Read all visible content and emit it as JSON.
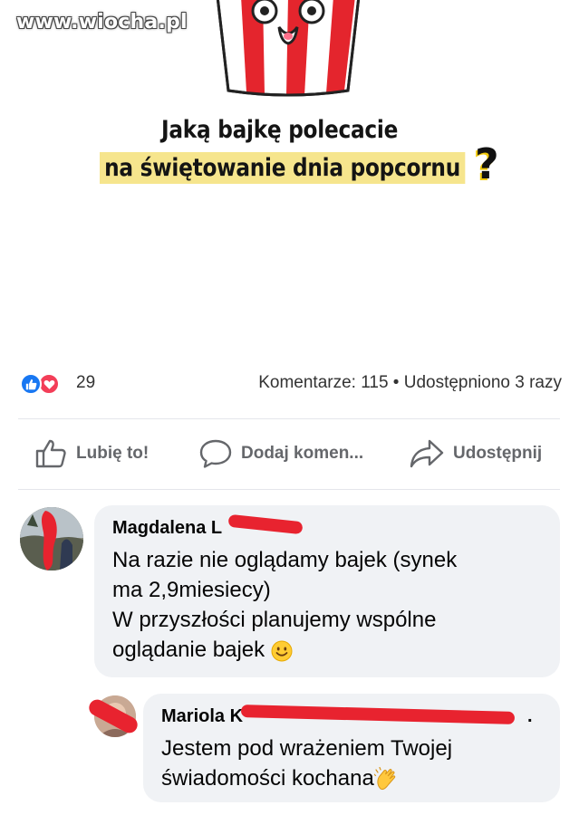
{
  "watermark": "www.wiocha.pl",
  "post": {
    "headline_line1": "Jaką bajkę polecacie",
    "headline_line2": "na świętowanie dnia popcornu",
    "headline_qmark": "?"
  },
  "stats": {
    "reaction_count": "29",
    "comments_and_shares": "Komentarze: 115 • Udostępniono 3 razy"
  },
  "actions": {
    "like": "Lubię to!",
    "comment": "Dodaj komen...",
    "share": "Udostępnij"
  },
  "comments": [
    {
      "author": "Magdalena L",
      "lines": [
        "Na razie nie oglądamy bajek (synek",
        "ma 2,9miesiecy)",
        "W przyszłości planujemy wspólne",
        "oglądanie bajek"
      ],
      "emoji": "smile-emoji"
    },
    {
      "author": "Mariola K",
      "author_tail": ".",
      "lines": [
        "Jestem pod wrażeniem Twojej",
        "świadomości kochana"
      ],
      "emoji": "clapping-hands-emoji"
    }
  ],
  "colors": {
    "like_blue": "#1877f2",
    "love_red": "#f33e58",
    "highlight_yellow": "#f6e58d",
    "bubble_gray": "#f0f2f5",
    "redaction_red": "#e8232f"
  }
}
